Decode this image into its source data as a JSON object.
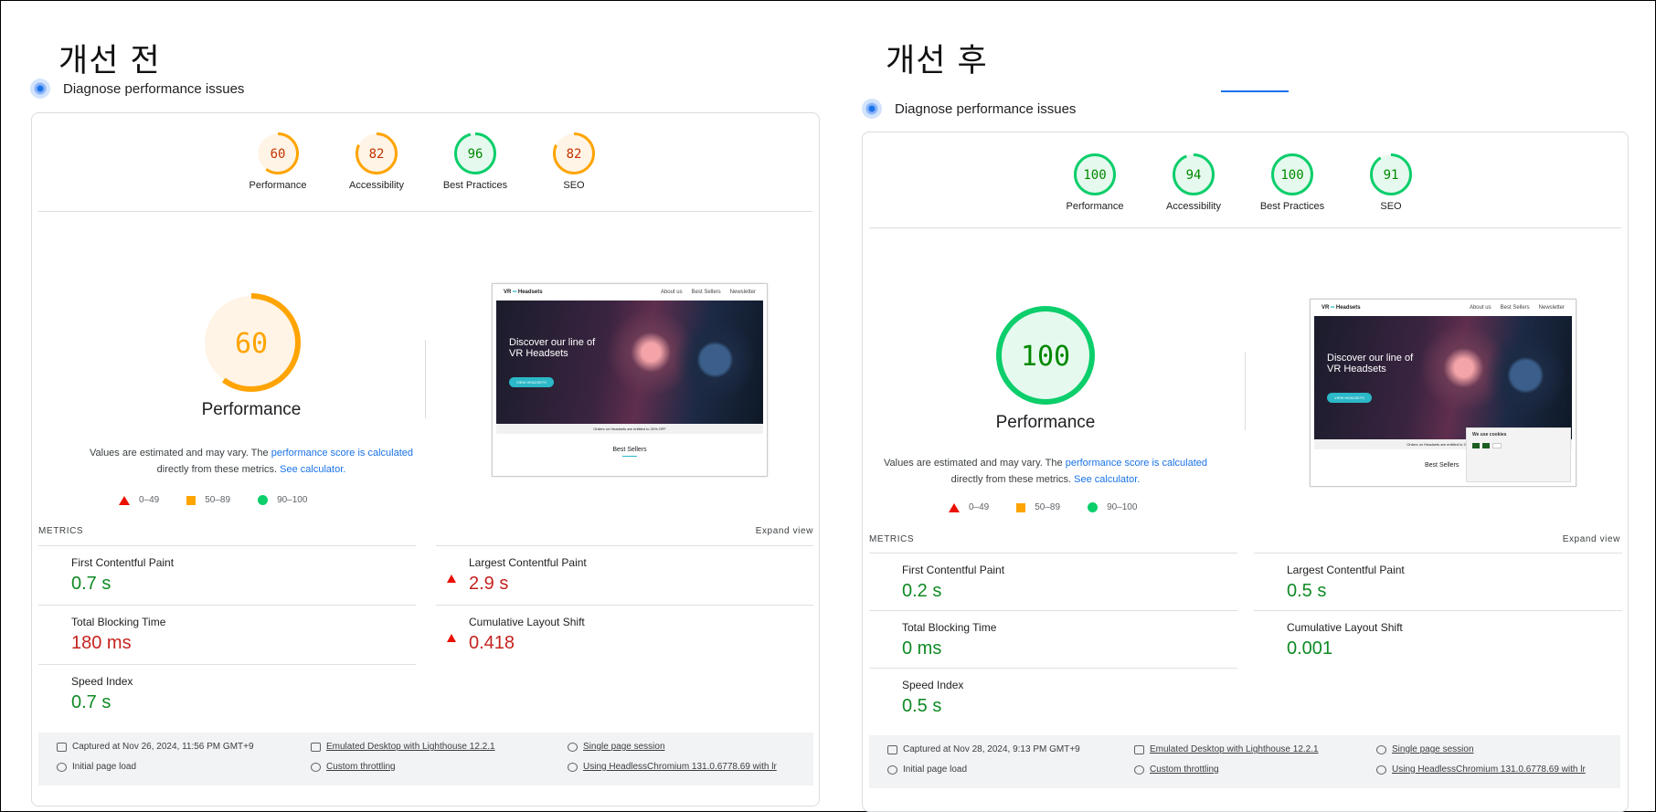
{
  "before": {
    "heading": "개선 전",
    "diagnose_title": "Diagnose performance issues",
    "gauges": [
      {
        "label": "Performance",
        "score": "60",
        "status": "average"
      },
      {
        "label": "Accessibility",
        "score": "82",
        "status": "average"
      },
      {
        "label": "Best Practices",
        "score": "96",
        "status": "pass"
      },
      {
        "label": "SEO",
        "score": "82",
        "status": "average"
      }
    ],
    "main_score": "60",
    "main_status": "average",
    "main_label": "Performance",
    "note_prefix": "Values are estimated and may vary. The ",
    "note_link": "performance score is calculated",
    "note_middle": "directly from these metrics. ",
    "note_calc": "See calculator.",
    "legend": {
      "fail": "0–49",
      "average": "50–89",
      "pass": "90–100"
    },
    "metrics_title": "METRICS",
    "expand_label": "Expand view",
    "metrics": [
      {
        "name": "First Contentful Paint",
        "value": "0.7 s",
        "status": "pass"
      },
      {
        "name": "Largest Contentful Paint",
        "value": "2.9 s",
        "status": "fail"
      },
      {
        "name": "Total Blocking Time",
        "value": "180 ms",
        "status": "average"
      },
      {
        "name": "Cumulative Layout Shift",
        "value": "0.418",
        "status": "fail"
      },
      {
        "name": "Speed Index",
        "value": "0.7 s",
        "status": "pass"
      }
    ],
    "footer": {
      "captured": "Captured at Nov 26, 2024, 11:56 PM GMT+9",
      "load": "Initial page load",
      "emulation": "Emulated Desktop with Lighthouse 12.2.1",
      "throttling": "Custom throttling",
      "session": "Single page session",
      "browser": "Using HeadlessChromium 131.0.6778.69 with lr"
    }
  },
  "after": {
    "heading": "개선 후",
    "diagnose_title": "Diagnose performance issues",
    "gauges": [
      {
        "label": "Performance",
        "score": "100",
        "status": "pass"
      },
      {
        "label": "Accessibility",
        "score": "94",
        "status": "pass"
      },
      {
        "label": "Best Practices",
        "score": "100",
        "status": "pass"
      },
      {
        "label": "SEO",
        "score": "91",
        "status": "pass"
      }
    ],
    "main_score": "100",
    "main_status": "pass",
    "main_label": "Performance",
    "note_prefix": "Values are estimated and may vary. The ",
    "note_link": "performance score is calculated",
    "note_middle": "directly from these metrics. ",
    "note_calc": "See calculator.",
    "legend": {
      "fail": "0–49",
      "average": "50–89",
      "pass": "90–100"
    },
    "metrics_title": "METRICS",
    "expand_label": "Expand view",
    "metrics": [
      {
        "name": "First Contentful Paint",
        "value": "0.2 s",
        "status": "pass"
      },
      {
        "name": "Largest Contentful Paint",
        "value": "0.5 s",
        "status": "pass"
      },
      {
        "name": "Total Blocking Time",
        "value": "0 ms",
        "status": "pass"
      },
      {
        "name": "Cumulative Layout Shift",
        "value": "0.001",
        "status": "pass"
      },
      {
        "name": "Speed Index",
        "value": "0.5 s",
        "status": "pass"
      }
    ],
    "footer": {
      "captured": "Captured at Nov 28, 2024, 9:13 PM GMT+9",
      "load": "Initial page load",
      "emulation": "Emulated Desktop with Lighthouse 12.2.1",
      "throttling": "Custom throttling",
      "session": "Single page session",
      "browser": "Using HeadlessChromium 131.0.6778.69 with lr"
    }
  },
  "screenshot": {
    "brand": "VR",
    "brand_suffix": "Headsets",
    "nav": [
      "About us",
      "Best Sellers",
      "Newsletter"
    ],
    "hero_title_1": "Discover our line of",
    "hero_title_2": "VR Headsets",
    "promo": "Orders on Headsets are entitled to 20% OFF",
    "best_sellers": "Best Sellers",
    "cookie_title": "We use cookies"
  },
  "colors": {
    "pass": "#0cce6b",
    "pass_text": "#008800",
    "pass_bg": "#e6f9ee",
    "average": "#ffa400",
    "average_text": "#c33300",
    "average_bg": "#fff4e5",
    "fail": "#ff4e42",
    "link": "#1a73e8"
  }
}
